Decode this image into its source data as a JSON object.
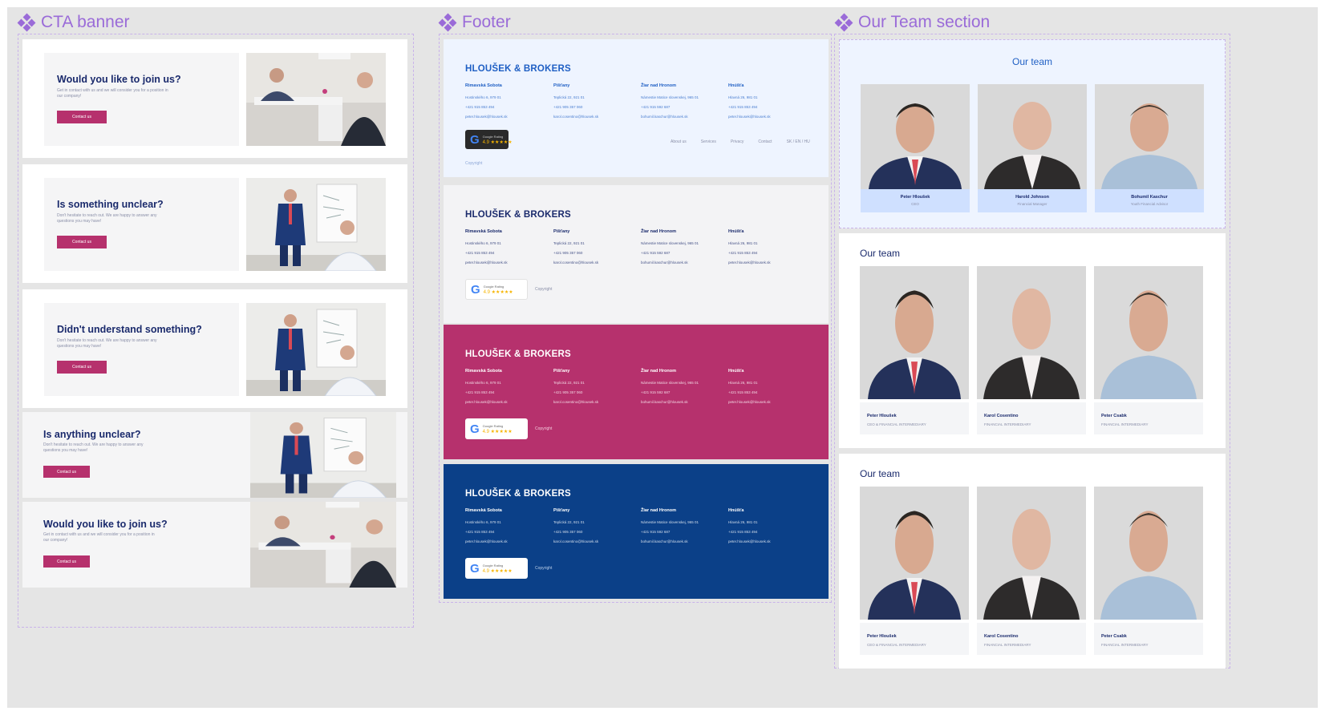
{
  "colors": {
    "canvas": "#e5e5e5",
    "component_label": "#9a6bd8",
    "navy": "#1a2a6c",
    "accent": "#b6316d",
    "footer_light_bg": "#eef4ff",
    "footer_gray_bg": "#f3f3f5",
    "footer_magenta_bg": "#b6316d",
    "footer_navy_bg": "#0b4088",
    "team_light_bg": "#eef4ff",
    "team_label_bg": "#cfe0ff",
    "team_card_bg": "#f4f5f7"
  },
  "labels": {
    "cta": "CTA banner",
    "footer": "Footer",
    "team": "Our Team section"
  },
  "cta": {
    "cards": [
      {
        "title": "Would you like to join us?",
        "text": "Get in contact with us and we will consider you for a position in our company!",
        "button": "Contact us",
        "scene": "office"
      },
      {
        "title": "Is something unclear?",
        "text": "Don't hesitate to reach out. We are happy to answer any questions you may have!",
        "button": "Contact us",
        "scene": "whiteboard"
      },
      {
        "title": "Didn't understand something?",
        "text": "Don't hesitate to reach out. We are happy to answer any questions you may have!",
        "button": "Contact us",
        "scene": "whiteboard"
      },
      {
        "title": "Is anything unclear?",
        "text": "Don't hesitate to reach out. We are happy to answer any questions you may have!",
        "button": "Contact us",
        "scene": "whiteboard"
      },
      {
        "title": "Would you like to join us?",
        "text": "Get in contact with us and we will consider you for a position in our company!",
        "button": "Contact us",
        "scene": "office"
      }
    ]
  },
  "footer": {
    "brand": "HLOUŠEK & BROKERS",
    "columns": [
      {
        "city": "Rimavská Sobota",
        "lines": [
          "Hostinského 6, 979 01",
          "+421 915 853 494",
          "peter.hlousek@hlousek.sk"
        ]
      },
      {
        "city": "Pišťany",
        "lines": [
          "Teplická 22, 921 01",
          "+421 905 357 060",
          "karol.cosentino@hlousek.sk"
        ]
      },
      {
        "city": "Žiar nad Hronom",
        "lines": [
          "Námestie Matice slovenskej, 965 01",
          "+421 915 592 687",
          "bohumil.kaschur@hlousek.sk"
        ]
      },
      {
        "city": "Hnúšťa",
        "lines": [
          "Hlavná 26, 981 01",
          "+421 915 853 494",
          "peter.hlousek@hlousek.sk"
        ]
      }
    ],
    "copyright": "Copyright",
    "links": [
      "About us",
      "Services",
      "Privacy",
      "Contact",
      "SK / EN / HU"
    ],
    "google_label": "Google Rating",
    "google_rating": "4.9 ★★★★★"
  },
  "team": {
    "title": "Our team",
    "highlight_members": [
      {
        "name": "Peter Hloušek",
        "role": "CEO"
      },
      {
        "name": "Harold Johnson",
        "role": "Financial Manager"
      },
      {
        "name": "Bohumil Kaschur",
        "role": "Youth Financial Advisor"
      }
    ],
    "members": [
      {
        "name": "Peter Hloušek",
        "role": "CEO & FINANCIAL INTERMEDIARY"
      },
      {
        "name": "Karol Cosentino",
        "role": "FINANCIAL INTERMEDIARY"
      },
      {
        "name": "Peter Csabk",
        "role": "FINANCIAL INTERMEDIARY"
      }
    ]
  }
}
